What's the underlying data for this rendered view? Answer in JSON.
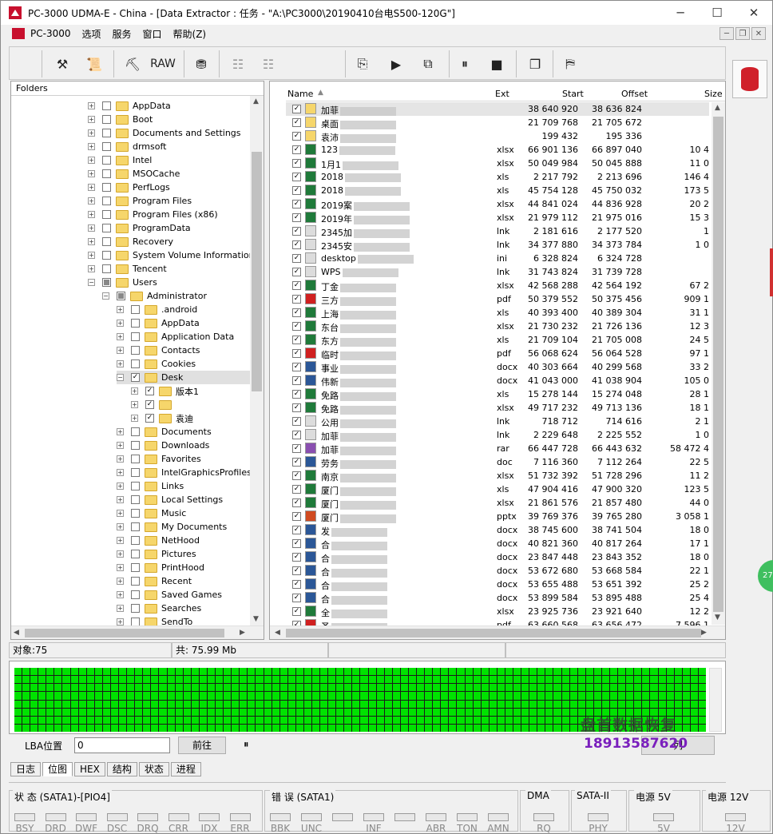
{
  "window": {
    "title": "PC-3000 UDMA-E - China - [Data Extractor : 任务 - \"A:\\PC3000\\20190410台电S500-120G\"]",
    "minimize": "─",
    "maximize": "☐",
    "close": "✕"
  },
  "menu": [
    "PC-3000",
    "选项",
    "服务",
    "窗口",
    "帮助(Z)"
  ],
  "toolbar": {
    "raw_label": "RAW"
  },
  "folders": {
    "header": "Folders",
    "items": [
      {
        "label": "AppData",
        "level": 0
      },
      {
        "label": "Boot",
        "level": 0
      },
      {
        "label": "Documents and Settings",
        "level": 0
      },
      {
        "label": "drmsoft",
        "level": 0
      },
      {
        "label": "Intel",
        "level": 0
      },
      {
        "label": "MSOCache",
        "level": 0
      },
      {
        "label": "PerfLogs",
        "level": 0
      },
      {
        "label": "Program Files",
        "level": 0
      },
      {
        "label": "Program Files (x86)",
        "level": 0
      },
      {
        "label": "ProgramData",
        "level": 0
      },
      {
        "label": "Recovery",
        "level": 0
      },
      {
        "label": "System Volume Information",
        "level": 0
      },
      {
        "label": "Tencent",
        "level": 0
      },
      {
        "label": "Users",
        "level": 0
      },
      {
        "label": "Administrator",
        "level": 1
      },
      {
        "label": ".android",
        "level": 2
      },
      {
        "label": "AppData",
        "level": 2
      },
      {
        "label": "Application Data",
        "level": 2
      },
      {
        "label": "Contacts",
        "level": 2
      },
      {
        "label": "Cookies",
        "level": 2
      },
      {
        "label": "Desk",
        "level": 2
      },
      {
        "label": "版本1",
        "level": 3
      },
      {
        "label": "",
        "level": 3
      },
      {
        "label": "袁迪",
        "level": 3
      },
      {
        "label": "Documents",
        "level": 2
      },
      {
        "label": "Downloads",
        "level": 2
      },
      {
        "label": "Favorites",
        "level": 2
      },
      {
        "label": "IntelGraphicsProfiles",
        "level": 2
      },
      {
        "label": "Links",
        "level": 2
      },
      {
        "label": "Local Settings",
        "level": 2
      },
      {
        "label": "Music",
        "level": 2
      },
      {
        "label": "My Documents",
        "level": 2
      },
      {
        "label": "NetHood",
        "level": 2
      },
      {
        "label": "Pictures",
        "level": 2
      },
      {
        "label": "PrintHood",
        "level": 2
      },
      {
        "label": "Recent",
        "level": 2
      },
      {
        "label": "Saved Games",
        "level": 2
      },
      {
        "label": "Searches",
        "level": 2
      },
      {
        "label": "SendTo",
        "level": 2
      }
    ]
  },
  "files": {
    "columns": {
      "name": "Name",
      "ext": "Ext",
      "start": "Start",
      "offset": "Offset",
      "size": "Size"
    },
    "rows": [
      {
        "name": "加菲",
        "ext": "",
        "start": "38 640 920",
        "offset": "38 636 824",
        "size": "",
        "icon": "folder"
      },
      {
        "name": "桌面",
        "ext": "",
        "start": "21 709 768",
        "offset": "21 705 672",
        "size": "",
        "icon": "folder"
      },
      {
        "name": "袁沛",
        "ext": "",
        "start": "199 432",
        "offset": "195 336",
        "size": "",
        "icon": "folder"
      },
      {
        "name": "123",
        "ext": "xlsx",
        "start": "66 901 136",
        "offset": "66 897 040",
        "size": "10 4",
        "icon": "xls"
      },
      {
        "name": "1月1",
        "ext": "xlsx",
        "start": "50 049 984",
        "offset": "50 045 888",
        "size": "11 0",
        "icon": "xls"
      },
      {
        "name": "2018",
        "ext": "xls",
        "start": "2 217 792",
        "offset": "2 213 696",
        "size": "146 4",
        "icon": "xls"
      },
      {
        "name": "2018",
        "ext": "xls",
        "start": "45 754 128",
        "offset": "45 750 032",
        "size": "173 5",
        "icon": "xls"
      },
      {
        "name": "2019案",
        "ext": "xlsx",
        "start": "44 841 024",
        "offset": "44 836 928",
        "size": "20 2",
        "icon": "xls"
      },
      {
        "name": "2019年",
        "ext": "xlsx",
        "start": "21 979 112",
        "offset": "21 975 016",
        "size": "15 3",
        "icon": "xls"
      },
      {
        "name": "2345加",
        "ext": "lnk",
        "start": "2 181 616",
        "offset": "2 177 520",
        "size": "1",
        "icon": "lnk"
      },
      {
        "name": "2345安",
        "ext": "lnk",
        "start": "34 377 880",
        "offset": "34 373 784",
        "size": "1 0",
        "icon": "lnk"
      },
      {
        "name": "desktop",
        "ext": "ini",
        "start": "6 328 824",
        "offset": "6 324 728",
        "size": "",
        "icon": "ini"
      },
      {
        "name": "WPS",
        "ext": "lnk",
        "start": "31 743 824",
        "offset": "31 739 728",
        "size": "",
        "icon": "lnk"
      },
      {
        "name": "丁金",
        "ext": "xlsx",
        "start": "42 568 288",
        "offset": "42 564 192",
        "size": "67 2",
        "icon": "xls"
      },
      {
        "name": "三方",
        "ext": "pdf",
        "start": "50 379 552",
        "offset": "50 375 456",
        "size": "909 1",
        "icon": "pdf"
      },
      {
        "name": "上海",
        "ext": "xls",
        "start": "40 393 400",
        "offset": "40 389 304",
        "size": "31 1",
        "icon": "xls"
      },
      {
        "name": "东台",
        "ext": "xlsx",
        "start": "21 730 232",
        "offset": "21 726 136",
        "size": "12 3",
        "icon": "xls"
      },
      {
        "name": "东方",
        "ext": "xls",
        "start": "21 709 104",
        "offset": "21 705 008",
        "size": "24 5",
        "icon": "xls"
      },
      {
        "name": "临时",
        "ext": "pdf",
        "start": "56 068 624",
        "offset": "56 064 528",
        "size": "97 1",
        "icon": "pdf"
      },
      {
        "name": "事业",
        "ext": "docx",
        "start": "40 303 664",
        "offset": "40 299 568",
        "size": "33 2",
        "icon": "doc"
      },
      {
        "name": "伟新",
        "ext": "docx",
        "start": "41 043 000",
        "offset": "41 038 904",
        "size": "105 0",
        "icon": "doc"
      },
      {
        "name": "免路",
        "ext": "xls",
        "start": "15 278 144",
        "offset": "15 274 048",
        "size": "28 1",
        "icon": "xls"
      },
      {
        "name": "免路",
        "ext": "xlsx",
        "start": "49 717 232",
        "offset": "49 713 136",
        "size": "18 1",
        "icon": "xls"
      },
      {
        "name": "公用",
        "ext": "lnk",
        "start": "718 712",
        "offset": "714 616",
        "size": "2 1",
        "icon": "lnk"
      },
      {
        "name": "加菲",
        "ext": "lnk",
        "start": "2 229 648",
        "offset": "2 225 552",
        "size": "1 0",
        "icon": "lnk"
      },
      {
        "name": "加菲",
        "ext": "rar",
        "start": "66 447 728",
        "offset": "66 443 632",
        "size": "58 472 4",
        "icon": "rar"
      },
      {
        "name": "劳务",
        "ext": "doc",
        "start": "7 116 360",
        "offset": "7 112 264",
        "size": "22 5",
        "icon": "doc"
      },
      {
        "name": "南京",
        "ext": "xlsx",
        "start": "51 732 392",
        "offset": "51 728 296",
        "size": "11 2",
        "icon": "xls"
      },
      {
        "name": "厦门",
        "ext": "xls",
        "start": "47 904 416",
        "offset": "47 900 320",
        "size": "123 5",
        "icon": "xls"
      },
      {
        "name": "厦门",
        "ext": "xlsx",
        "start": "21 861 576",
        "offset": "21 857 480",
        "size": "44 0",
        "icon": "xls"
      },
      {
        "name": "厦门",
        "ext": "pptx",
        "start": "39 769 376",
        "offset": "39 765 280",
        "size": "3 058 1",
        "icon": "ppt"
      },
      {
        "name": "发",
        "ext": "docx",
        "start": "38 745 600",
        "offset": "38 741 504",
        "size": "18 0",
        "icon": "doc"
      },
      {
        "name": "合",
        "ext": "docx",
        "start": "40 821 360",
        "offset": "40 817 264",
        "size": "17 1",
        "icon": "doc"
      },
      {
        "name": "合",
        "ext": "docx",
        "start": "23 847 448",
        "offset": "23 843 352",
        "size": "18 0",
        "icon": "doc"
      },
      {
        "name": "合",
        "ext": "docx",
        "start": "53 672 680",
        "offset": "53 668 584",
        "size": "22 1",
        "icon": "doc"
      },
      {
        "name": "合",
        "ext": "docx",
        "start": "53 655 488",
        "offset": "53 651 392",
        "size": "25 2",
        "icon": "doc"
      },
      {
        "name": "合",
        "ext": "docx",
        "start": "53 899 584",
        "offset": "53 895 488",
        "size": "25 4",
        "icon": "doc"
      },
      {
        "name": "全",
        "ext": "xlsx",
        "start": "23 925 736",
        "offset": "23 921 640",
        "size": "12 2",
        "icon": "xls"
      },
      {
        "name": "圣",
        "ext": "pdf",
        "start": "63 660 568",
        "offset": "63 656 472",
        "size": "7 596 1",
        "icon": "pdf"
      }
    ]
  },
  "status": {
    "objects": "对象:75",
    "total": "共: 75.99 Mb"
  },
  "lba": {
    "label": "LBA位置",
    "value": "0",
    "go": "前往",
    "pause": "⏸",
    "btn2": "列"
  },
  "watermark": {
    "line1": "盘首数据恢复",
    "line2": "18913587620"
  },
  "tabs": [
    "日志",
    "位图",
    "HEX",
    "结构",
    "状态",
    "进程"
  ],
  "groups": {
    "status_title": "状 态 (SATA1)-[PIO4]",
    "status_leds": [
      "BSY",
      "DRD",
      "DWF",
      "DSC",
      "DRQ",
      "CRR",
      "IDX",
      "ERR"
    ],
    "error_title": "错 误 (SATA1)",
    "error_leds": [
      "BBK",
      "UNC",
      "",
      "INF",
      "",
      "ABR",
      "TON",
      "AMN"
    ],
    "dma_title": "DMA",
    "dma_leds": [
      "RQ"
    ],
    "sata_title": "SATA-II",
    "sata_leds": [
      "PHY"
    ],
    "p5_title": "电源 5V",
    "p5_leds": [
      "5V"
    ],
    "p12_title": "电源 12V",
    "p12_leds": [
      "12V"
    ]
  },
  "side_badge": "27"
}
